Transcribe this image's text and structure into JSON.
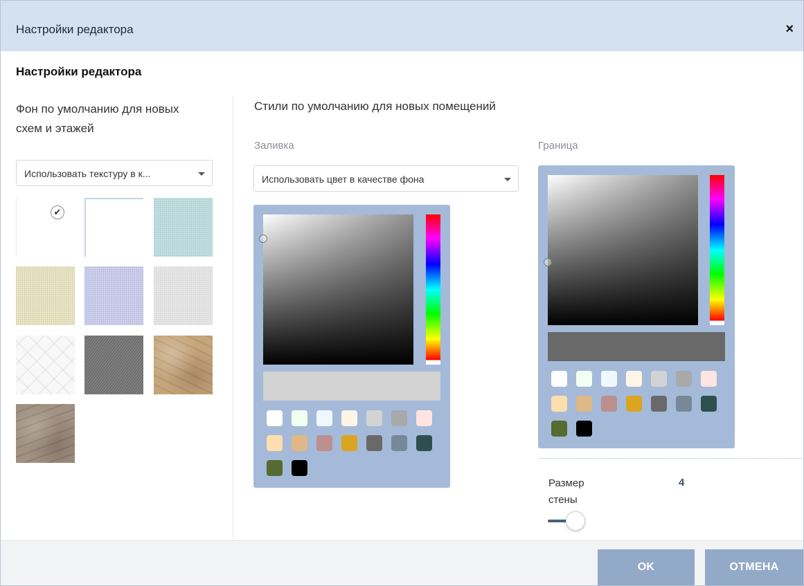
{
  "dialog": {
    "title": "Настройки редактора",
    "close": "×",
    "heading": "Настройки редактора"
  },
  "left": {
    "label": "Фон по умолчанию для новых схем и этажей",
    "select_value": "Использовать текстуру в к...",
    "textures": [
      {
        "name": "white",
        "selected": true
      },
      {
        "name": "white-outline",
        "selected": false
      },
      {
        "name": "light-blue-linen",
        "selected": false
      },
      {
        "name": "beige-linen",
        "selected": false
      },
      {
        "name": "lavender-linen",
        "selected": false
      },
      {
        "name": "grey-linen",
        "selected": false
      },
      {
        "name": "white-pattern",
        "selected": false
      },
      {
        "name": "grey-noise",
        "selected": false
      },
      {
        "name": "tan-leather",
        "selected": false
      },
      {
        "name": "taupe-leather",
        "selected": false
      }
    ],
    "check_glyph": "✔"
  },
  "right": {
    "section_title": "Стили по умолчанию для новых помещений",
    "fill": {
      "label": "Заливка",
      "select_value": "Использовать цвет в качестве фона",
      "preview_color": "#d2d2d2"
    },
    "border": {
      "label": "Граница",
      "preview_color": "#696969"
    },
    "swatches": [
      "#ffffff",
      "#f0fff0",
      "#f0f8ff",
      "#fdf5e6",
      "#d3d3d3",
      "#a9a9a9",
      "#ffe4e1",
      "#ffdead",
      "#deb887",
      "#bc8f8f",
      "#daa520",
      "#696969",
      "#778899",
      "#2f4f4f",
      "#556b2f",
      "#000000"
    ],
    "wall": {
      "label": "Размер стены",
      "value": "4"
    }
  },
  "footer": {
    "ok": "OK",
    "cancel": "ОТМЕНА"
  },
  "colors": {
    "titlebar": "#d4e1f0",
    "picker_bg": "#a4bad8",
    "button": "#93a9c8"
  }
}
